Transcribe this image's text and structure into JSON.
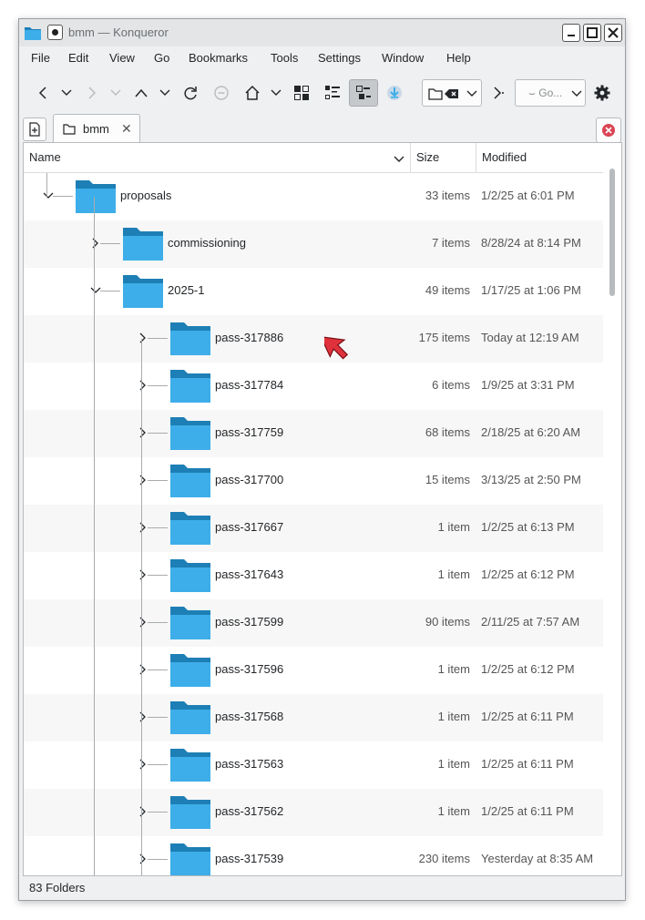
{
  "window": {
    "title": "bmm — Konqueror"
  },
  "menu": [
    "File",
    "Edit",
    "View",
    "Go",
    "Bookmarks",
    "Tools",
    "Settings",
    "Window",
    "Help"
  ],
  "toolbar": {
    "location_placeholder": "Go..."
  },
  "tab": {
    "label": "bmm"
  },
  "columns": {
    "name": "Name",
    "size": "Size",
    "modified": "Modified"
  },
  "rows": [
    {
      "name": "proposals",
      "size": "33 items",
      "modified": "1/2/25 at 6:01 PM",
      "depth": 0,
      "expanded": true
    },
    {
      "name": "commissioning",
      "size": "7 items",
      "modified": "8/28/24 at 8:14 PM",
      "depth": 1,
      "expanded": false
    },
    {
      "name": "2025-1",
      "size": "49 items",
      "modified": "1/17/25 at 1:06 PM",
      "depth": 1,
      "expanded": true
    },
    {
      "name": "pass-317886",
      "size": "175 items",
      "modified": "Today at 12:19 AM",
      "depth": 2,
      "expanded": false
    },
    {
      "name": "pass-317784",
      "size": "6 items",
      "modified": "1/9/25 at 3:31 PM",
      "depth": 2,
      "expanded": false
    },
    {
      "name": "pass-317759",
      "size": "68 items",
      "modified": "2/18/25 at 6:20 AM",
      "depth": 2,
      "expanded": false
    },
    {
      "name": "pass-317700",
      "size": "15 items",
      "modified": "3/13/25 at 2:50 PM",
      "depth": 2,
      "expanded": false
    },
    {
      "name": "pass-317667",
      "size": "1 item",
      "modified": "1/2/25 at 6:13 PM",
      "depth": 2,
      "expanded": false
    },
    {
      "name": "pass-317643",
      "size": "1 item",
      "modified": "1/2/25 at 6:12 PM",
      "depth": 2,
      "expanded": false
    },
    {
      "name": "pass-317599",
      "size": "90 items",
      "modified": "2/11/25 at 7:57 AM",
      "depth": 2,
      "expanded": false
    },
    {
      "name": "pass-317596",
      "size": "1 item",
      "modified": "1/2/25 at 6:12 PM",
      "depth": 2,
      "expanded": false
    },
    {
      "name": "pass-317568",
      "size": "1 item",
      "modified": "1/2/25 at 6:11 PM",
      "depth": 2,
      "expanded": false
    },
    {
      "name": "pass-317563",
      "size": "1 item",
      "modified": "1/2/25 at 6:11 PM",
      "depth": 2,
      "expanded": false
    },
    {
      "name": "pass-317562",
      "size": "1 item",
      "modified": "1/2/25 at 6:11 PM",
      "depth": 2,
      "expanded": false
    },
    {
      "name": "pass-317539",
      "size": "230 items",
      "modified": "Yesterday at 8:35 AM",
      "depth": 2,
      "expanded": false
    }
  ],
  "status": {
    "text": "83 Folders"
  },
  "colors": {
    "folder": "#3daee9",
    "folder_dark": "#1d7fb5",
    "accent": "#3daee9",
    "cursor": "#e0323c"
  },
  "icons": {
    "folder": "folder-icon",
    "expand": "chevron-right-icon",
    "collapse": "chevron-down-icon"
  }
}
